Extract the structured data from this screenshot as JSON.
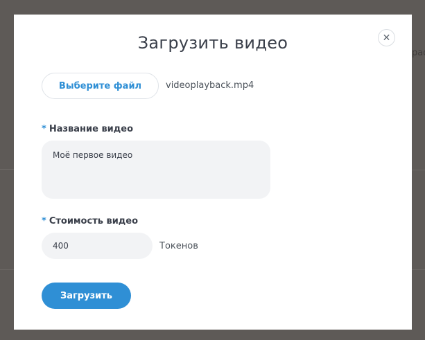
{
  "backdrop": {
    "edge_text": "раф"
  },
  "modal": {
    "title": "Загрузить видео",
    "close_icon": "close-icon",
    "file_button_label": "Выберите файл",
    "file_name": "videoplayback.mp4",
    "required_mark": "*",
    "title_field": {
      "label": "Название видео",
      "value": "Моё первое видео"
    },
    "price_field": {
      "label": "Стоимость видео",
      "value": "400",
      "unit": "Токенов"
    },
    "submit_label": "Загрузить"
  },
  "colors": {
    "accent": "#2f8fd5",
    "overlay": "#5e5a57",
    "field_bg": "#f2f3f5"
  }
}
